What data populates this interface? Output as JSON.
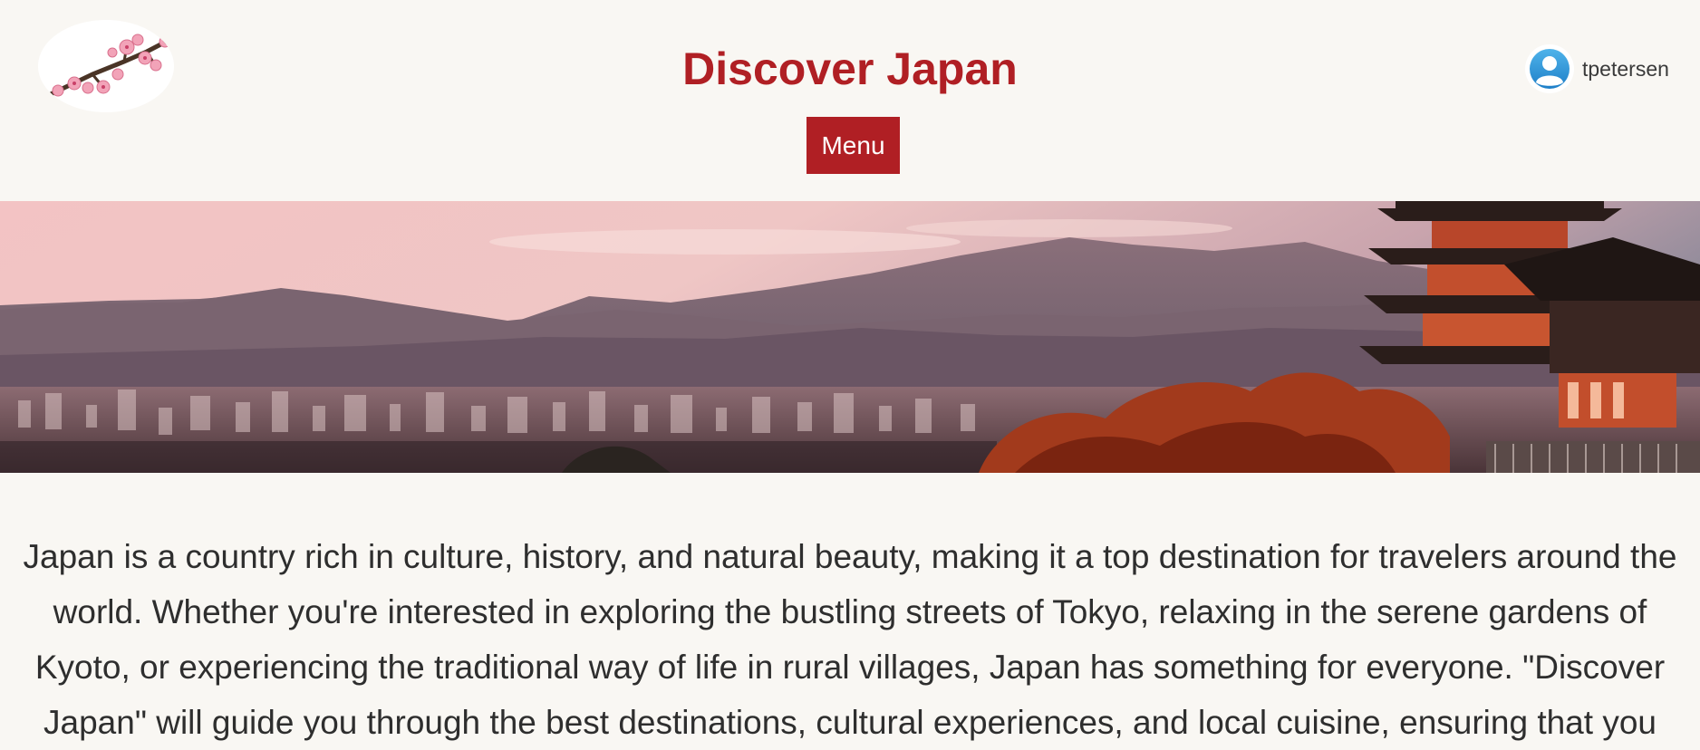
{
  "header": {
    "title": "Discover Japan",
    "menu_label": "Menu",
    "user": {
      "username": "tpetersen",
      "avatar_icon": "user-avatar-icon"
    },
    "logo_icon": "cherry-blossom-icon"
  },
  "colors": {
    "brand": "#b01f24",
    "background": "#f9f7f3",
    "text": "#2e2e2e"
  },
  "main": {
    "intro_text": "Japan is a country rich in culture, history, and natural beauty, making it a top destination for travelers around the\nworld. Whether you're interested in exploring the bustling streets of Tokyo, relaxing in the serene gardens of\nKyoto, or experiencing the traditional way of life in rural villages, Japan has something for everyone. \"Discover\nJapan\" will guide you through the best destinations, cultural experiences, and local cuisine, ensuring that you"
  }
}
